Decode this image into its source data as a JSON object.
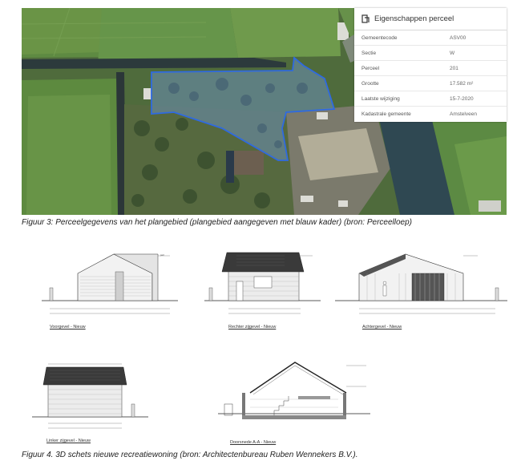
{
  "map": {
    "panel": {
      "title": "Eigenschappen perceel",
      "rows": [
        {
          "label": "Gemeentecode",
          "value": "ASV00"
        },
        {
          "label": "Sectie",
          "value": "W"
        },
        {
          "label": "Perceel",
          "value": "201"
        },
        {
          "label": "Grootte",
          "value": "17.582 m²"
        },
        {
          "label": "Laatste wijziging",
          "value": "15-7-2020"
        },
        {
          "label": "Kadastrale gemeente",
          "value": "Amstelveen"
        }
      ]
    },
    "colors": {
      "outline": "#2f6ae0",
      "water": "#2d3b3f",
      "field": "#5f8a3f"
    }
  },
  "captions": {
    "figure3": "Figuur 3: Perceelgegevens van het plangebied (plangebied aangegeven met blauw kader) (bron: Perceelloep)",
    "figure4": "Figuur 4. 3D schets nieuwe recreatiewoning (bron: Architectenbureau Ruben Wennekers B.V.)."
  },
  "drawings": {
    "voorgevel": "Voorgevel - Nieuw",
    "rechter": "Rechter zijgevel - Nieuw",
    "achtergevel": "Achtergevel - Nieuw",
    "linker": "Linker zijgevel - Nieuw",
    "doorsnede": "Doorsnede A-A - Nieuw"
  }
}
